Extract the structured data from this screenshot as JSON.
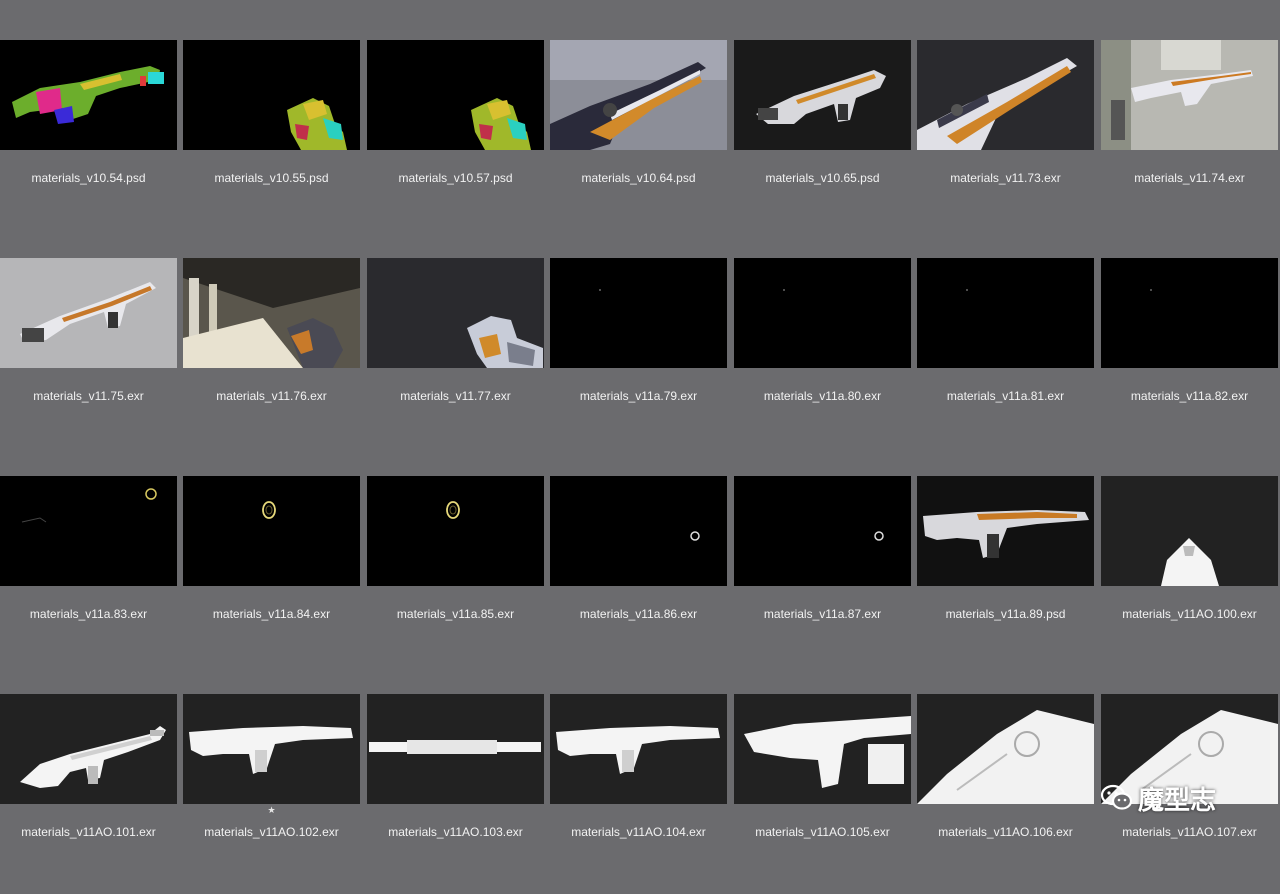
{
  "files": [
    {
      "name": "materials_v10.54.psd",
      "thumb": "wireframe-colored-gun"
    },
    {
      "name": "materials_v10.55.psd",
      "thumb": "wireframe-colored-gun-partial"
    },
    {
      "name": "materials_v10.57.psd",
      "thumb": "wireframe-colored-gun-partial"
    },
    {
      "name": "materials_v10.64.psd",
      "thumb": "textured-gun-grey-studio"
    },
    {
      "name": "materials_v10.65.psd",
      "thumb": "textured-gun-dark"
    },
    {
      "name": "materials_v11.73.exr",
      "thumb": "textured-gun-closeup"
    },
    {
      "name": "materials_v11.74.exr",
      "thumb": "textured-gun-office"
    },
    {
      "name": "materials_v11.75.exr",
      "thumb": "textured-gun-concrete"
    },
    {
      "name": "materials_v11.76.exr",
      "thumb": "textured-gun-corridor"
    },
    {
      "name": "materials_v11.77.exr",
      "thumb": "textured-gun-hand"
    },
    {
      "name": "materials_v11a.79.exr",
      "thumb": "black-pass"
    },
    {
      "name": "materials_v11a.80.exr",
      "thumb": "black-pass"
    },
    {
      "name": "materials_v11a.81.exr",
      "thumb": "black-pass"
    },
    {
      "name": "materials_v11a.82.exr",
      "thumb": "black-pass"
    },
    {
      "name": "materials_v11a.83.exr",
      "thumb": "glow-pass-rings"
    },
    {
      "name": "materials_v11a.84.exr",
      "thumb": "glow-pass-ring"
    },
    {
      "name": "materials_v11a.85.exr",
      "thumb": "glow-pass-ring"
    },
    {
      "name": "materials_v11a.86.exr",
      "thumb": "glow-pass-dot"
    },
    {
      "name": "materials_v11a.87.exr",
      "thumb": "glow-pass-dot"
    },
    {
      "name": "materials_v11a.89.psd",
      "thumb": "textured-gun-side"
    },
    {
      "name": "materials_v11AO.100.exr",
      "thumb": "ao-gun-front"
    },
    {
      "name": "materials_v11AO.101.exr",
      "thumb": "ao-gun-angled"
    },
    {
      "name": "materials_v11AO.102.exr",
      "thumb": "ao-gun-side"
    },
    {
      "name": "materials_v11AO.103.exr",
      "thumb": "ao-gun-top"
    },
    {
      "name": "materials_v11AO.104.exr",
      "thumb": "ao-gun-side"
    },
    {
      "name": "materials_v11AO.105.exr",
      "thumb": "ao-gun-side-large"
    },
    {
      "name": "materials_v11AO.106.exr",
      "thumb": "ao-gun-closeup"
    },
    {
      "name": "materials_v11AO.107.exr",
      "thumb": "ao-gun-closeup"
    }
  ],
  "rating_mark": "★",
  "watermark": {
    "text": "魔型志",
    "icon": "wechat-logo-icon"
  },
  "colors": {
    "background": "#6b6b6e",
    "label": "#f2f2f2",
    "thumb_bg": "#000000"
  }
}
